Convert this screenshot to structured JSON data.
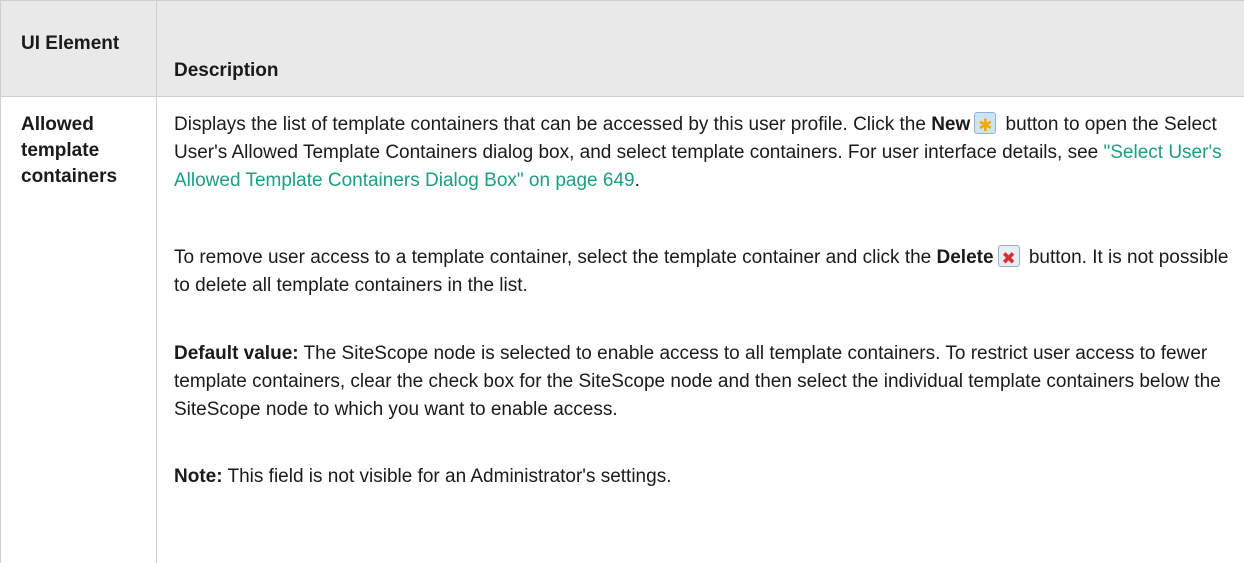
{
  "header": {
    "col1": "UI Element",
    "col2": "Description"
  },
  "row": {
    "label": "Allowed template containers",
    "p1": {
      "t1": "Displays the list of template containers that can be accessed by this user profile. Click the ",
      "new_label": "New",
      "t2": " button to open the Select User's Allowed Template Containers dialog box, and select template containers. For user interface details, see ",
      "link": "\"Select User's Allowed Template Containers Dialog Box\" on page 649",
      "t3": "."
    },
    "p2": {
      "t1": "To remove user access to a template container, select the template container and click the ",
      "delete_label": "Delete",
      "t2": " button. It is not possible to delete all template containers in the list."
    },
    "p3": {
      "label": "Default value:",
      "text": " The SiteScope node is selected to enable access to all template containers. To restrict user access to fewer template containers, clear the check box for the SiteScope node and then select the individual template containers below the SiteScope node to which you want to enable access."
    },
    "p4": {
      "label": "Note:",
      "text": " This field is not visible for an Administrator's settings."
    }
  },
  "icons": {
    "new": "new-star-icon",
    "delete": "delete-x-icon"
  },
  "colors": {
    "link": "#1c9e83",
    "header_bg": "#e9e9e9"
  }
}
